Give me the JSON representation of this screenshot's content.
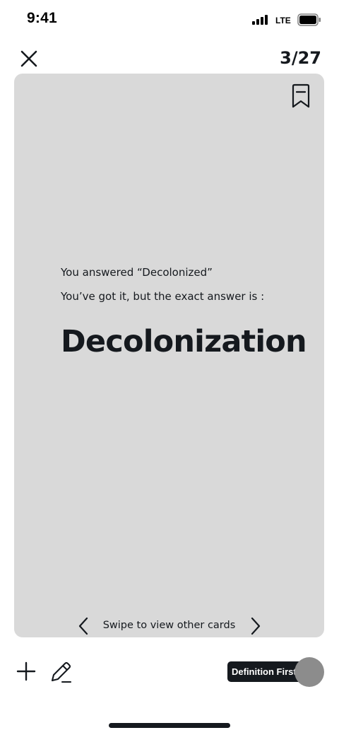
{
  "status_bar": {
    "time": "9:41",
    "network": "LTE",
    "icons": [
      "signal-icon",
      "battery-icon"
    ]
  },
  "header": {
    "close_icon": "close-icon",
    "counter": "3/27"
  },
  "card": {
    "bookmark_icon": "bookmark-icon",
    "answered_text": "You answered “Decolonized”",
    "exact_text": "You’ve got it, but the exact answer is :",
    "answer": "Decolonization",
    "swipe_text": "Swipe to view other cards",
    "nav_icons": [
      "chevron-left-icon",
      "chevron-right-icon"
    ]
  },
  "toolbar": {
    "add_icon": "plus-icon",
    "edit_icon": "pencil-icon",
    "toggle_label": "Definition First",
    "toggle_on": false
  },
  "colors": {
    "card_background": "#d9d9d9",
    "text": "#15191e",
    "toggle_knob": "#8c8c8c"
  }
}
